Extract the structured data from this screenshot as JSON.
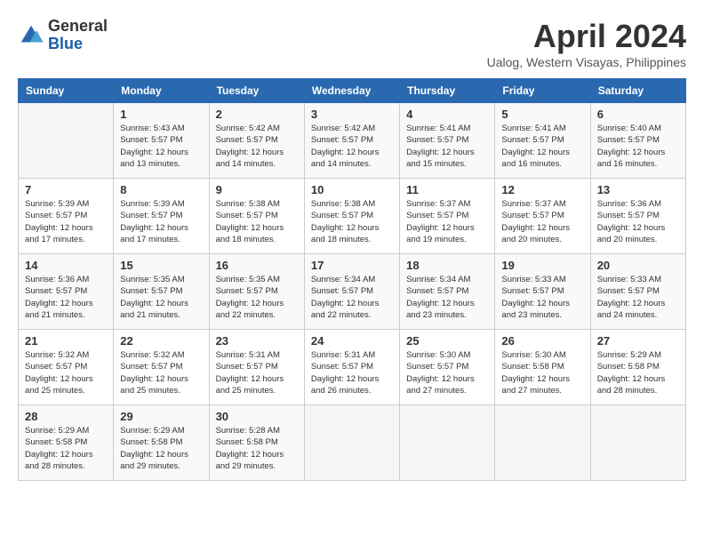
{
  "logo": {
    "general": "General",
    "blue": "Blue"
  },
  "title": "April 2024",
  "location": "Ualog, Western Visayas, Philippines",
  "days_header": [
    "Sunday",
    "Monday",
    "Tuesday",
    "Wednesday",
    "Thursday",
    "Friday",
    "Saturday"
  ],
  "weeks": [
    [
      {
        "day": "",
        "sunrise": "",
        "sunset": "",
        "daylight": ""
      },
      {
        "day": "1",
        "sunrise": "Sunrise: 5:43 AM",
        "sunset": "Sunset: 5:57 PM",
        "daylight": "Daylight: 12 hours and 13 minutes."
      },
      {
        "day": "2",
        "sunrise": "Sunrise: 5:42 AM",
        "sunset": "Sunset: 5:57 PM",
        "daylight": "Daylight: 12 hours and 14 minutes."
      },
      {
        "day": "3",
        "sunrise": "Sunrise: 5:42 AM",
        "sunset": "Sunset: 5:57 PM",
        "daylight": "Daylight: 12 hours and 14 minutes."
      },
      {
        "day": "4",
        "sunrise": "Sunrise: 5:41 AM",
        "sunset": "Sunset: 5:57 PM",
        "daylight": "Daylight: 12 hours and 15 minutes."
      },
      {
        "day": "5",
        "sunrise": "Sunrise: 5:41 AM",
        "sunset": "Sunset: 5:57 PM",
        "daylight": "Daylight: 12 hours and 16 minutes."
      },
      {
        "day": "6",
        "sunrise": "Sunrise: 5:40 AM",
        "sunset": "Sunset: 5:57 PM",
        "daylight": "Daylight: 12 hours and 16 minutes."
      }
    ],
    [
      {
        "day": "7",
        "sunrise": "Sunrise: 5:39 AM",
        "sunset": "Sunset: 5:57 PM",
        "daylight": "Daylight: 12 hours and 17 minutes."
      },
      {
        "day": "8",
        "sunrise": "Sunrise: 5:39 AM",
        "sunset": "Sunset: 5:57 PM",
        "daylight": "Daylight: 12 hours and 17 minutes."
      },
      {
        "day": "9",
        "sunrise": "Sunrise: 5:38 AM",
        "sunset": "Sunset: 5:57 PM",
        "daylight": "Daylight: 12 hours and 18 minutes."
      },
      {
        "day": "10",
        "sunrise": "Sunrise: 5:38 AM",
        "sunset": "Sunset: 5:57 PM",
        "daylight": "Daylight: 12 hours and 18 minutes."
      },
      {
        "day": "11",
        "sunrise": "Sunrise: 5:37 AM",
        "sunset": "Sunset: 5:57 PM",
        "daylight": "Daylight: 12 hours and 19 minutes."
      },
      {
        "day": "12",
        "sunrise": "Sunrise: 5:37 AM",
        "sunset": "Sunset: 5:57 PM",
        "daylight": "Daylight: 12 hours and 20 minutes."
      },
      {
        "day": "13",
        "sunrise": "Sunrise: 5:36 AM",
        "sunset": "Sunset: 5:57 PM",
        "daylight": "Daylight: 12 hours and 20 minutes."
      }
    ],
    [
      {
        "day": "14",
        "sunrise": "Sunrise: 5:36 AM",
        "sunset": "Sunset: 5:57 PM",
        "daylight": "Daylight: 12 hours and 21 minutes."
      },
      {
        "day": "15",
        "sunrise": "Sunrise: 5:35 AM",
        "sunset": "Sunset: 5:57 PM",
        "daylight": "Daylight: 12 hours and 21 minutes."
      },
      {
        "day": "16",
        "sunrise": "Sunrise: 5:35 AM",
        "sunset": "Sunset: 5:57 PM",
        "daylight": "Daylight: 12 hours and 22 minutes."
      },
      {
        "day": "17",
        "sunrise": "Sunrise: 5:34 AM",
        "sunset": "Sunset: 5:57 PM",
        "daylight": "Daylight: 12 hours and 22 minutes."
      },
      {
        "day": "18",
        "sunrise": "Sunrise: 5:34 AM",
        "sunset": "Sunset: 5:57 PM",
        "daylight": "Daylight: 12 hours and 23 minutes."
      },
      {
        "day": "19",
        "sunrise": "Sunrise: 5:33 AM",
        "sunset": "Sunset: 5:57 PM",
        "daylight": "Daylight: 12 hours and 23 minutes."
      },
      {
        "day": "20",
        "sunrise": "Sunrise: 5:33 AM",
        "sunset": "Sunset: 5:57 PM",
        "daylight": "Daylight: 12 hours and 24 minutes."
      }
    ],
    [
      {
        "day": "21",
        "sunrise": "Sunrise: 5:32 AM",
        "sunset": "Sunset: 5:57 PM",
        "daylight": "Daylight: 12 hours and 25 minutes."
      },
      {
        "day": "22",
        "sunrise": "Sunrise: 5:32 AM",
        "sunset": "Sunset: 5:57 PM",
        "daylight": "Daylight: 12 hours and 25 minutes."
      },
      {
        "day": "23",
        "sunrise": "Sunrise: 5:31 AM",
        "sunset": "Sunset: 5:57 PM",
        "daylight": "Daylight: 12 hours and 25 minutes."
      },
      {
        "day": "24",
        "sunrise": "Sunrise: 5:31 AM",
        "sunset": "Sunset: 5:57 PM",
        "daylight": "Daylight: 12 hours and 26 minutes."
      },
      {
        "day": "25",
        "sunrise": "Sunrise: 5:30 AM",
        "sunset": "Sunset: 5:57 PM",
        "daylight": "Daylight: 12 hours and 27 minutes."
      },
      {
        "day": "26",
        "sunrise": "Sunrise: 5:30 AM",
        "sunset": "Sunset: 5:58 PM",
        "daylight": "Daylight: 12 hours and 27 minutes."
      },
      {
        "day": "27",
        "sunrise": "Sunrise: 5:29 AM",
        "sunset": "Sunset: 5:58 PM",
        "daylight": "Daylight: 12 hours and 28 minutes."
      }
    ],
    [
      {
        "day": "28",
        "sunrise": "Sunrise: 5:29 AM",
        "sunset": "Sunset: 5:58 PM",
        "daylight": "Daylight: 12 hours and 28 minutes."
      },
      {
        "day": "29",
        "sunrise": "Sunrise: 5:29 AM",
        "sunset": "Sunset: 5:58 PM",
        "daylight": "Daylight: 12 hours and 29 minutes."
      },
      {
        "day": "30",
        "sunrise": "Sunrise: 5:28 AM",
        "sunset": "Sunset: 5:58 PM",
        "daylight": "Daylight: 12 hours and 29 minutes."
      },
      {
        "day": "",
        "sunrise": "",
        "sunset": "",
        "daylight": ""
      },
      {
        "day": "",
        "sunrise": "",
        "sunset": "",
        "daylight": ""
      },
      {
        "day": "",
        "sunrise": "",
        "sunset": "",
        "daylight": ""
      },
      {
        "day": "",
        "sunrise": "",
        "sunset": "",
        "daylight": ""
      }
    ]
  ]
}
